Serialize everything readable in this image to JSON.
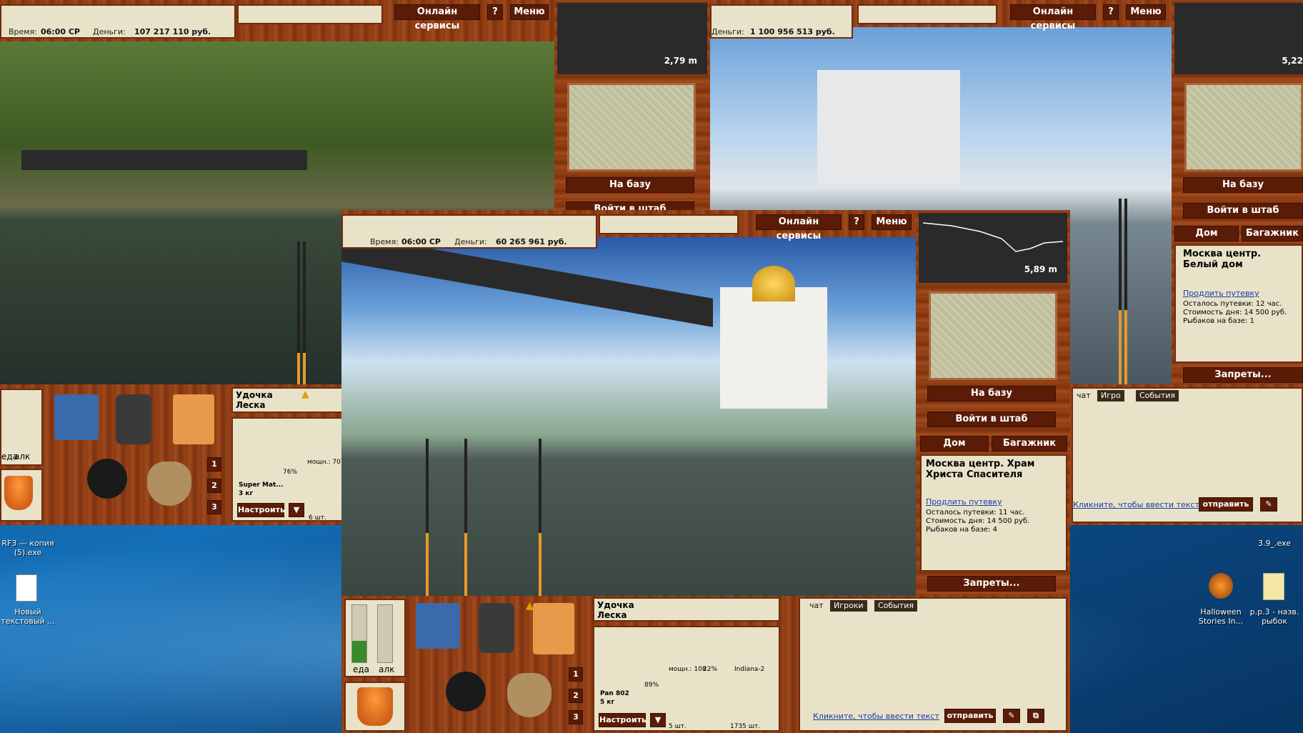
{
  "desktop": {
    "icons": [
      {
        "label": "RF3 — копия (5).exe"
      },
      {
        "label": "Новый текстовый ..."
      },
      {
        "label": "3.9_.exe"
      },
      {
        "label": "Halloween Stories In..."
      },
      {
        "label": "p.p.3 - назв. рыбок"
      }
    ]
  },
  "win_left": {
    "time_label": "Время:",
    "time_value": "06:00 СР",
    "money_label": "Деньги:",
    "money_value": "107 217 110 руб.",
    "services": "Онлайн сервисы",
    "help": "?",
    "menu": "Меню",
    "depth": "2,79 m",
    "to_base": "На базу",
    "hq": "Войти в штаб",
    "food": "еда",
    "alc": "алк",
    "rod_label": "Удочка",
    "line_label": "Леска",
    "rod_name": "Super Mat...",
    "rod_weight": "3 кг",
    "rod_pct": "76%",
    "reel_power": "мощн.: 70",
    "bait_count": "6 шт.",
    "setup": "Настроить",
    "slots": [
      "1",
      "2",
      "3"
    ]
  },
  "win_right": {
    "money_label": "Деньги:",
    "money_value": "1 100 956 513 руб.",
    "services": "Онлайн сервисы",
    "help": "?",
    "menu": "Меню",
    "depth": "5,22",
    "to_base": "На базу",
    "hq": "Войти в штаб",
    "home_tab": "Дом",
    "trunk_tab": "Багажник",
    "location": "Москва центр. Белый дом",
    "extend": "Продлить путевку",
    "left": "Осталось путевки: 12 час.",
    "price": "Стоимость дня: 14 500 руб.",
    "fishers": "Рыбаков на базе: 1",
    "bans": "Запреты...",
    "chat_tab": "чат",
    "players_tab": "Игро",
    "events_tab": "События",
    "chat_prompt": "Кликните, чтобы ввести текст",
    "send": "отправить"
  },
  "win_main": {
    "time_label": "Время:",
    "time_value": "06:00 СР",
    "money_label": "Деньги:",
    "money_value": "60 265 961 руб.",
    "services": "Онлайн сервисы",
    "help": "?",
    "menu": "Меню",
    "depth": "5,89 m",
    "to_base": "На базу",
    "hq": "Войти в штаб",
    "home_tab": "Дом",
    "trunk_tab": "Багажник",
    "location": "Москва центр. Храм Христа Спасителя",
    "extend": "Продлить путевку",
    "left": "Осталось путевки: 11 час.",
    "price": "Стоимость дня: 14 500 руб.",
    "fishers": "Рыбаков на базе: 4",
    "bans": "Запреты...",
    "food": "еда",
    "alc": "алк",
    "rod_label": "Удочка",
    "line_label": "Леска",
    "rod_name": "Pan 802",
    "rod_weight": "5 кг",
    "rod_pct": "89%",
    "reel_power": "мощн.: 108",
    "reel_pct": "22%",
    "bait_name": "Indiana-2",
    "hook_count": "5 шт.",
    "fish_count": "1735 шт.",
    "setup": "Настроить",
    "slots": [
      "1",
      "2",
      "3"
    ],
    "chat_tab": "чат",
    "players_tab": "Игроки",
    "events_tab": "События",
    "chat_prompt": "Кликните, чтобы ввести текст",
    "send": "отправить"
  },
  "colors": {
    "wood": "#8a3a14",
    "panel": "#e8e2c8",
    "button": "#5a1c06",
    "desktop": "#0e5a9c"
  }
}
